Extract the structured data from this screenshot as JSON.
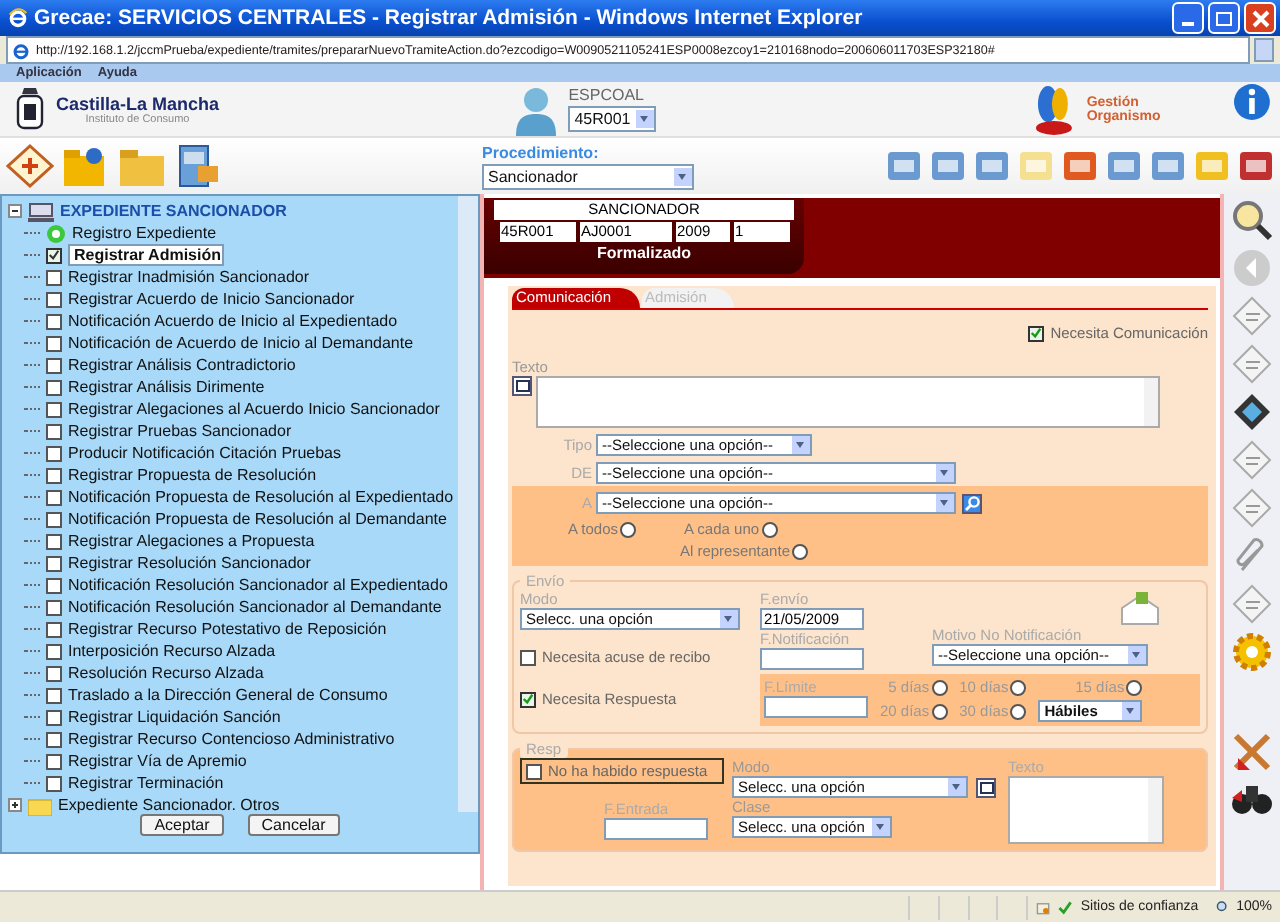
{
  "window": {
    "title": "Grecae: SERVICIOS CENTRALES - Registrar Admisión - Windows Internet Explorer",
    "address": "http://192.168.1.2/jccmPrueba/expediente/tramites/prepararNuevoTramiteAction.do?ezcodigo=W0090521105241ESP0008ezcoy1=210168nodo=200606011703ESP32180#"
  },
  "menu": [
    "Aplicación",
    "Ayuda"
  ],
  "header": {
    "org_name": "Castilla-La Mancha",
    "org_sub": "Instituto de Consumo",
    "user": "ESPCOAL",
    "office": "45R001",
    "module": "Gestión Organismo"
  },
  "toolbar": {
    "procedure_label": "Procedimiento:",
    "procedure": "Sancionador"
  },
  "tree": [
    {
      "label": "EXPEDIENTE SANCIONADOR",
      "expanded": true,
      "children": [
        {
          "label": "Registro Expediente",
          "kind": "done",
          "selected": false
        },
        {
          "label": "Registrar Admisión",
          "kind": "task",
          "checked": true,
          "selected": true
        },
        {
          "label": "Registrar Inadmisión Sancionador",
          "kind": "task",
          "checked": false,
          "selected": false
        },
        {
          "label": "Registrar Acuerdo de Inicio Sancionador",
          "kind": "task",
          "checked": false,
          "selected": false
        },
        {
          "label": "Notificación Acuerdo de Inicio al Expedientado",
          "kind": "task",
          "checked": false,
          "selected": false
        },
        {
          "label": "Notificación de Acuerdo de Inicio al Demandante",
          "kind": "task",
          "checked": false,
          "selected": false
        },
        {
          "label": "Registrar Análisis Contradictorio",
          "kind": "task",
          "checked": false,
          "selected": false
        },
        {
          "label": "Registrar Análisis Dirimente",
          "kind": "task",
          "checked": false,
          "selected": false
        },
        {
          "label": "Registrar Alegaciones al Acuerdo Inicio Sancionador",
          "kind": "task",
          "checked": false,
          "selected": false
        },
        {
          "label": "Registrar Pruebas Sancionador",
          "kind": "task",
          "checked": false,
          "selected": false
        },
        {
          "label": "Producir Notificación Citación Pruebas",
          "kind": "task",
          "checked": false,
          "selected": false
        },
        {
          "label": "Registrar Propuesta de Resolución",
          "kind": "task",
          "checked": false,
          "selected": false
        },
        {
          "label": "Notificación Propuesta de Resolución al Expedientado",
          "kind": "task",
          "checked": false,
          "selected": false
        },
        {
          "label": "Notificación Propuesta de Resolución al Demandante",
          "kind": "task",
          "checked": false,
          "selected": false
        },
        {
          "label": "Registrar Alegaciones a Propuesta",
          "kind": "task",
          "checked": false,
          "selected": false
        },
        {
          "label": "Registrar Resolución Sancionador",
          "kind": "task",
          "checked": false,
          "selected": false
        },
        {
          "label": "Notificación Resolución Sancionador al Expedientado",
          "kind": "task",
          "checked": false,
          "selected": false
        },
        {
          "label": "Notificación Resolución Sancionador al Demandante",
          "kind": "task",
          "checked": false,
          "selected": false
        },
        {
          "label": "Registrar Recurso Potestativo de Reposición",
          "kind": "task",
          "checked": false,
          "selected": false
        },
        {
          "label": "Interposición Recurso Alzada",
          "kind": "task",
          "checked": false,
          "selected": false
        },
        {
          "label": "Resolución Recurso Alzada",
          "kind": "task",
          "checked": false,
          "selected": false
        },
        {
          "label": "Traslado a la Dirección General de Consumo",
          "kind": "task",
          "checked": false,
          "selected": false
        },
        {
          "label": "Registrar Liquidación Sanción",
          "kind": "task",
          "checked": false,
          "selected": false
        },
        {
          "label": "Registrar Recurso Contencioso Administrativo",
          "kind": "task",
          "checked": false,
          "selected": false
        },
        {
          "label": "Registrar Vía de Apremio",
          "kind": "task",
          "checked": false,
          "selected": false
        },
        {
          "label": "Registrar Terminación",
          "kind": "task",
          "checked": false,
          "selected": false
        }
      ]
    },
    {
      "label": "Expediente Sancionador. Otros",
      "expanded": false
    }
  ],
  "tree_buttons": [
    "Aceptar",
    "Cancelar"
  ],
  "record": {
    "type": "SANCIONADOR",
    "fields": [
      "45R001",
      "AJ0001",
      "2009",
      "1"
    ],
    "status": "Formalizado"
  },
  "tabs": [
    {
      "label": "Comunicación",
      "selected": true
    },
    {
      "label": "Admisión",
      "selected": false
    }
  ],
  "communication": {
    "needs": {
      "label": "Necesita Comunicación",
      "checked": true
    },
    "text_label": "Texto",
    "tipo": {
      "label": "Tipo",
      "value": "--Seleccione una opción--"
    },
    "de": {
      "label": "DE",
      "value": "--Seleccione una opción--"
    },
    "a": {
      "label": "A",
      "value": "--Seleccione una opción--"
    },
    "recipients": [
      {
        "label": "A todos",
        "selected": false
      },
      {
        "label": "A cada uno",
        "selected": false
      },
      {
        "label": "Al representante",
        "selected": false
      }
    ]
  },
  "envio": {
    "legend": "Envío",
    "modo_label": "Modo",
    "modo": "Selecc. una opción",
    "fenvio_label": "F.envío",
    "fenvio": "21/05/2009",
    "fnotif_label": "F.Notificación",
    "motivo_label": "Motivo No Notificación",
    "motivo": "--Seleccione una opción--",
    "acuse": {
      "label": "Necesita acuse de recibo",
      "checked": false
    },
    "respuesta": {
      "label": "Necesita Respuesta",
      "checked": true
    },
    "flimite_label": "F.Límite",
    "deadlines": [
      {
        "label": "5 días",
        "selected": false
      },
      {
        "label": "10 días",
        "selected": false
      },
      {
        "label": "15 días",
        "selected": false
      },
      {
        "label": "20 días",
        "selected": false
      },
      {
        "label": "30 días",
        "selected": false
      }
    ],
    "day_type": "Hábiles"
  },
  "resp": {
    "legend": "Resp",
    "no_response": {
      "label": "No ha habido respuesta",
      "checked": false
    },
    "modo_label": "Modo",
    "modo": "Selecc. una opción",
    "texto_label": "Texto",
    "fentrada_label": "F.Entrada",
    "clase_label": "Clase",
    "clase": "Selecc. una opción"
  },
  "status_bar": {
    "zone": "Sitios de confianza",
    "zoom": "100%"
  }
}
